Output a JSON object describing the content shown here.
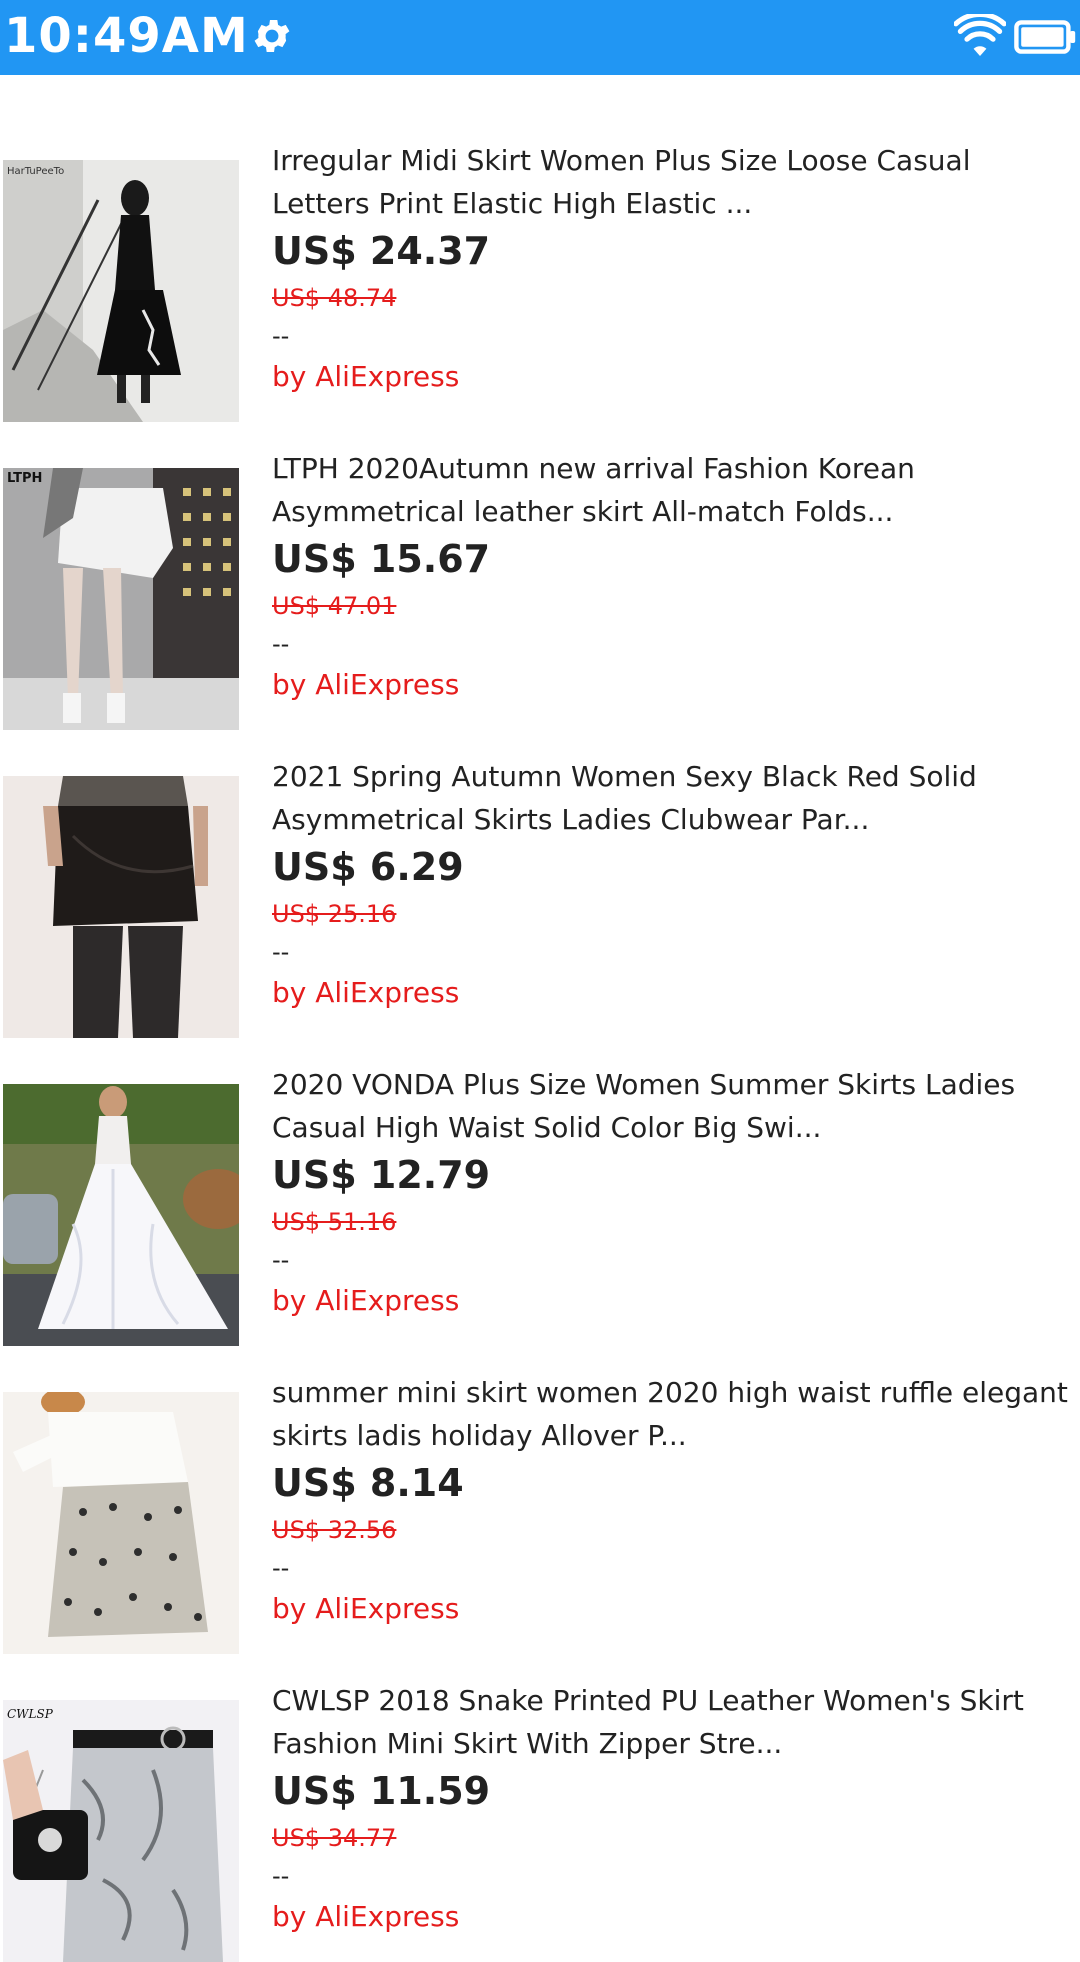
{
  "status_bar": {
    "time": "10:49AM",
    "icons": [
      "gear-icon",
      "wifi-icon",
      "battery-icon"
    ],
    "background": "#2196F3"
  },
  "colors": {
    "accent_red": "#e51c1c",
    "text": "#222222"
  },
  "products": [
    {
      "title": "Irregular Midi Skirt Women Plus Size Loose Casual Letters Print Elastic High Elastic ...",
      "price": "US$ 24.37",
      "original_price": "US$ 48.74",
      "rating": "--",
      "seller": "by AliExpress",
      "image_text": "HarTuPeeTo"
    },
    {
      "title": "LTPH 2020Autumn new arrival Fashion Korean Asymmetrical leather skirt All-match Folds...",
      "price": "US$ 15.67",
      "original_price": "US$ 47.01",
      "rating": "--",
      "seller": "by AliExpress",
      "image_text": "LTPH"
    },
    {
      "title": "2021 Spring Autumn Women Sexy Black Red Solid Asymmetrical Skirts Ladies Clubwear Par...",
      "price": "US$ 6.29",
      "original_price": "US$ 25.16",
      "rating": "--",
      "seller": "by AliExpress",
      "image_text": ""
    },
    {
      "title": "2020 VONDA Plus Size Women Summer Skirts Ladies Casual High Waist Solid Color Big Swi...",
      "price": "US$ 12.79",
      "original_price": "US$ 51.16",
      "rating": "--",
      "seller": "by AliExpress",
      "image_text": ""
    },
    {
      "title": "summer mini skirt women 2020 high waist ruffle elegant skirts ladis holiday Allover P...",
      "price": "US$ 8.14",
      "original_price": "US$ 32.56",
      "rating": "--",
      "seller": "by AliExpress",
      "image_text": ""
    },
    {
      "title": "CWLSP 2018 Snake Printed PU Leather Women's Skirt Fashion Mini Skirt With Zipper Stre...",
      "price": "US$ 11.59",
      "original_price": "US$ 34.77",
      "rating": "--",
      "seller": "by AliExpress",
      "image_text": "CWLSP"
    }
  ]
}
